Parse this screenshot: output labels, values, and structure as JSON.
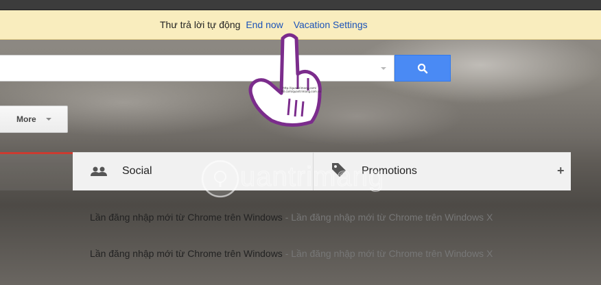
{
  "notice": {
    "message": "Thư trả lời tự động",
    "end_now": "End now",
    "vacation_settings": "Vacation Settings"
  },
  "search": {
    "value": "",
    "button_icon": "search-icon"
  },
  "toolbar": {
    "more_label": "More"
  },
  "tabs": [
    {
      "label": "Social",
      "icon": "people-icon"
    },
    {
      "label": "Promotions",
      "icon": "tag-icon"
    },
    {
      "label": "+",
      "icon": "plus-icon"
    }
  ],
  "emails": [
    {
      "subject": "Lần đăng nhập mới từ Chrome trên Windows",
      "snippet": " - Lần đăng nhập mới từ Chrome trên Windows X"
    },
    {
      "subject": "Lần đăng nhập mới từ Chrome trên Windows",
      "snippet": " - Lần đăng nhập mới từ Chrome trên Windows X"
    }
  ],
  "watermark": {
    "text": "uantrimang"
  },
  "hand_overlay": {
    "line1": "http://quantrimang.com/",
    "line2": "FB.com/quantrimang.com.vn"
  },
  "colors": {
    "notice_bg": "#f9edbe",
    "link": "#1a52b8",
    "search_button": "#4a8af4",
    "hand_outline": "#7b2c8c"
  }
}
